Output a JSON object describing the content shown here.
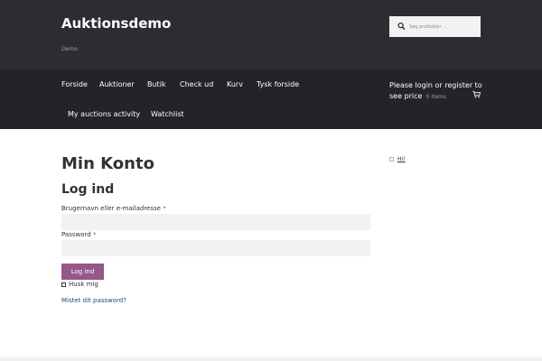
{
  "site": {
    "title": "Auktionsdemo",
    "tagline": "Demo"
  },
  "search": {
    "placeholder": "Søg produkter ..."
  },
  "nav": {
    "items": [
      "Forside",
      "Auktioner",
      "Butik",
      "Check ud",
      "Kurv",
      "Tysk forside",
      "My auctions activity",
      "Watchlist"
    ]
  },
  "account": {
    "text": "Please login or register to see price",
    "cart_count": "0 items"
  },
  "main": {
    "page_title": "Min Konto",
    "login_title": "Log ind",
    "username_label": "Brugernavn eller e-mailadresse",
    "password_label": "Password",
    "required_mark": "*",
    "login_button": "Log ind",
    "remember_label": "Husk mig",
    "lost_password": "Mistet dit password?"
  },
  "sidebar": {
    "item_label": "Hi!"
  },
  "colors": {
    "header_bg": "#2c2d33",
    "nav_bg": "#232429",
    "button": "#96588a"
  }
}
